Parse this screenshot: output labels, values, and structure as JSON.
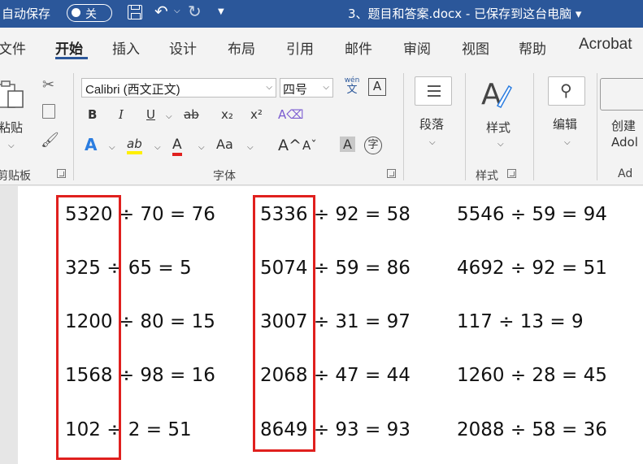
{
  "titlebar": {
    "autosave_label": "自动保存",
    "autosave_state": "关",
    "document_title": "3、题目和答案.docx - 已保存到这台电脑 ▾",
    "icons": [
      "save-icon",
      "undo-icon",
      "redo-icon",
      "customize-qat-icon"
    ],
    "bg_color": "#2b579a"
  },
  "tabs": [
    {
      "label": "文件"
    },
    {
      "label": "开始",
      "active": true
    },
    {
      "label": "插入"
    },
    {
      "label": "设计"
    },
    {
      "label": "布局"
    },
    {
      "label": "引用"
    },
    {
      "label": "邮件"
    },
    {
      "label": "审阅"
    },
    {
      "label": "视图"
    },
    {
      "label": "帮助"
    },
    {
      "label": "Acrobat"
    }
  ],
  "ribbon": {
    "clipboard": {
      "paste_label": "粘贴",
      "group_label": "剪贴板"
    },
    "font": {
      "name": "Calibri (西文正文)",
      "size": "四号",
      "phonetic_label": "wén",
      "phonetic_char": "文",
      "border_char": "A",
      "bold": "B",
      "italic": "I",
      "underline": "U",
      "strikethrough": "ab",
      "subscript": "x₂",
      "superscript": "x²",
      "text_effects": "A",
      "highlight": "ab",
      "font_color": "A",
      "change_case": "Aa",
      "grow": "A^",
      "shrink": "Aˇ",
      "shading": "A",
      "enclose": "字",
      "group_label": "字体"
    },
    "paragraph": {
      "label": "段落"
    },
    "styles": {
      "label": "样式",
      "group_label": "样式"
    },
    "editing": {
      "label": "编辑"
    },
    "adobe": {
      "label_line1": "创建",
      "label_line2": "Adol",
      "group_label": "Ad"
    }
  },
  "equations": [
    {
      "col": 0,
      "rows": [
        "5320 ÷ 70 = 76",
        "325 ÷ 65 = 5",
        "1200 ÷ 80 = 15",
        "1568 ÷ 98 = 16",
        "102 ÷ 2 = 51"
      ]
    },
    {
      "col": 1,
      "rows": [
        "5336 ÷ 92 = 58",
        "5074 ÷ 59 = 86",
        "3007 ÷ 31 = 97",
        "2068 ÷ 47 = 44",
        "8649 ÷ 93 = 93"
      ]
    },
    {
      "col": 2,
      "rows": [
        "5546 ÷ 59 = 94",
        "4692 ÷ 92 = 51",
        "117 ÷ 13 = 9",
        "1260 ÷ 28 = 45",
        "2088 ÷ 58 = 36"
      ]
    }
  ],
  "highlight_color": "#e0201e"
}
